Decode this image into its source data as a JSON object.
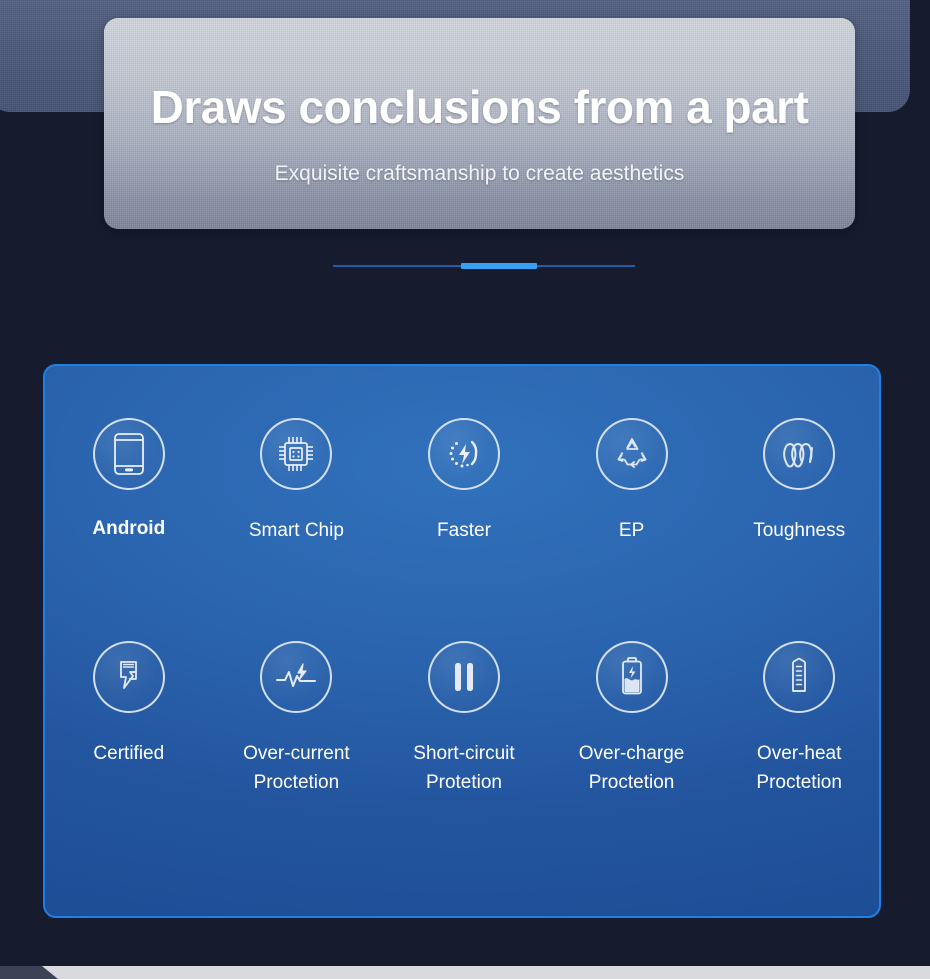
{
  "hero": {
    "title": "Draws conclusions from a part",
    "subtitle": "Exquisite craftsmanship to create aesthetics"
  },
  "carousel": {
    "total_slides": 3,
    "active_slide": 2,
    "track_color": "#1f5fa8",
    "active_color": "#35a0f4"
  },
  "theme": {
    "page_background": "#161b2e",
    "card_border": "#1d80e2",
    "card_background_top": "#3171bc",
    "card_background_bottom": "#1d4d95",
    "slab_color": "#4e5b7d",
    "footer_color": "#d8dade",
    "footer_wedge_color": "#3c4256"
  },
  "features": {
    "row1": [
      {
        "label": "Android",
        "icon": "smartphone-icon",
        "emphasis": true
      },
      {
        "label": "Smart Chip",
        "icon": "cpu-chip-icon",
        "emphasis": false
      },
      {
        "label": "Faster",
        "icon": "fast-charge-icon",
        "emphasis": false
      },
      {
        "label": "EP",
        "icon": "recycle-icon",
        "emphasis": false
      },
      {
        "label": "Toughness",
        "icon": "spring-coil-icon",
        "emphasis": false
      }
    ],
    "row2": [
      {
        "label": "Certified",
        "icon": "plug-bolt-icon",
        "emphasis": false
      },
      {
        "label": "Over-current\nProctetion",
        "icon": "waveform-bolt-icon",
        "emphasis": false
      },
      {
        "label": "Short-circuit\nProtetion",
        "icon": "pause-bars-icon",
        "emphasis": false
      },
      {
        "label": "Over-charge\nProctetion",
        "icon": "battery-bolt-icon",
        "emphasis": false
      },
      {
        "label": "Over-heat\nProctetion",
        "icon": "graduated-cylinder-icon",
        "emphasis": false
      }
    ]
  }
}
